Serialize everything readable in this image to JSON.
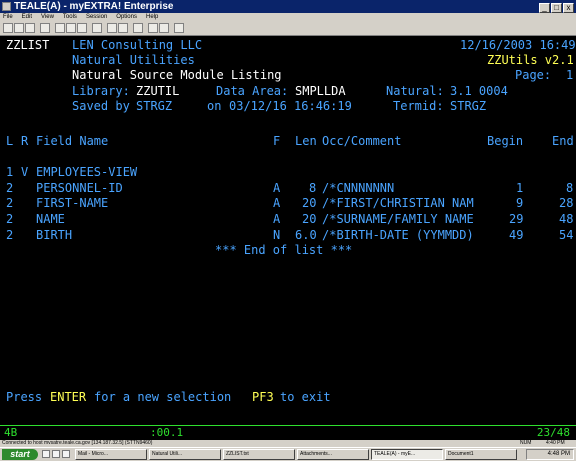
{
  "window": {
    "title": "TEALE(A) - myEXTRA! Enterprise",
    "buttons": [
      "_",
      "□",
      "x"
    ]
  },
  "menu": [
    "File",
    "Edit",
    "View",
    "Tools",
    "Session",
    "Options",
    "Help"
  ],
  "toolbar_icons": [
    "new-icon",
    "open-icon",
    "save-icon",
    "print-icon",
    "cut-icon",
    "copy-icon",
    "paste-icon",
    "find-icon",
    "font-icon",
    "color-icon",
    "macro-icon",
    "connect-icon",
    "disconnect-icon",
    "help-icon"
  ],
  "screen": {
    "program": "ZZLIST",
    "company": "LEN Consulting LLC",
    "datetime": "12/16/2003 16:49",
    "app_name": "Natural Utilities",
    "version": "ZZUtils v2.1",
    "report_title": "Natural Source Module Listing",
    "page_label": "Page:",
    "page_num": "1",
    "library_label": "Library:",
    "library": "ZZUTIL",
    "data_area_label": "Data Area:",
    "data_area": "SMPLLDA",
    "natural_label": "Natural:",
    "natural_ver": "3.1 0004",
    "saved_label": "Saved by",
    "saved_by": "STRGZ",
    "on_label": "on",
    "saved_on": "03/12/16 16:46:19",
    "termid_label": "Termid:",
    "termid": "STRGZ",
    "columns": {
      "l": "L",
      "r": "R",
      "field": "Field Name",
      "f": "F",
      "len": "Len",
      "occ": "Occ/Comment",
      "begin": "Begin",
      "end": "End"
    },
    "rows": [
      {
        "l": "1",
        "r": "V",
        "name": "EMPLOYEES-VIEW",
        "f": "",
        "len": "",
        "comment": "",
        "begin": "",
        "end": ""
      },
      {
        "l": "2",
        "r": "",
        "name": "PERSONNEL-ID",
        "f": "A",
        "len": "8",
        "comment": "/*CNNNNNNN",
        "begin": "1",
        "end": "8"
      },
      {
        "l": "2",
        "r": "",
        "name": "FIRST-NAME",
        "f": "A",
        "len": "20",
        "comment": "/*FIRST/CHRISTIAN NAM",
        "begin": "9",
        "end": "28"
      },
      {
        "l": "2",
        "r": "",
        "name": "NAME",
        "f": "A",
        "len": "20",
        "comment": "/*SURNAME/FAMILY NAME",
        "begin": "29",
        "end": "48"
      },
      {
        "l": "2",
        "r": "",
        "name": "BIRTH",
        "f": "N",
        "len": "6.0",
        "comment": "/*BIRTH-DATE (YYMMDD)",
        "begin": "49",
        "end": "54"
      }
    ],
    "end_of_list": "*** End of list ***",
    "footer": {
      "press": "Press",
      "enter": "ENTER",
      "new_sel": "for a new selection",
      "pf3": "PF3",
      "to_exit": "to exit"
    }
  },
  "status": {
    "indicator": "4B",
    "timer": ":00.1",
    "cursor": "23/48"
  },
  "connection": {
    "text": "Connected to host mvsatre.teale.ca.gov [134.187.32.5] (STTN9460)",
    "mode": "NUM",
    "time": "4:40 PM"
  },
  "taskbar": {
    "start": "start",
    "tasks": [
      "Mail - Micro...",
      "Natural Utili...",
      "ZZLIST.txt",
      "Attachments...",
      "TEALE(A) - myE...",
      "Document1"
    ],
    "clock": "4:48 PM"
  }
}
